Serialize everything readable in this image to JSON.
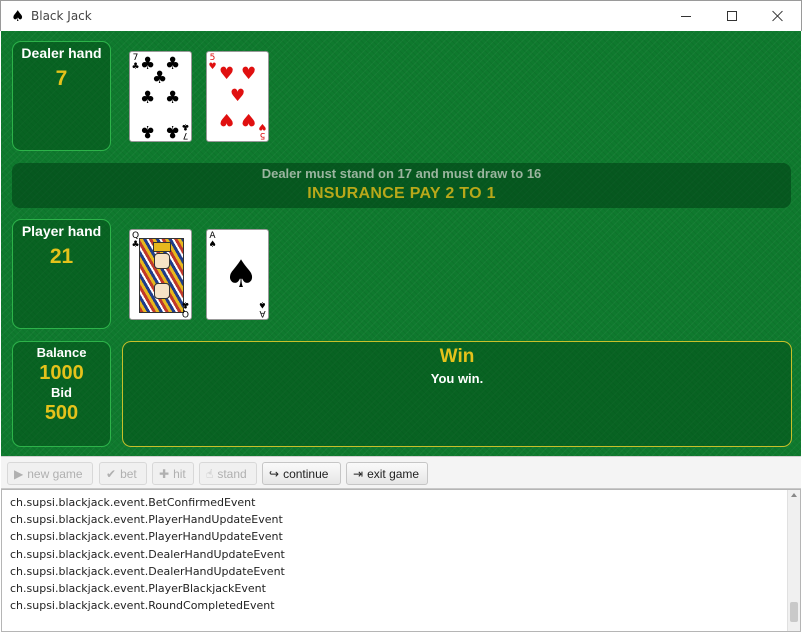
{
  "window": {
    "title": "Black Jack",
    "icon": "spade-icon"
  },
  "dealer": {
    "label": "Dealer hand",
    "value": "7",
    "cards": [
      {
        "rank": "7",
        "suit": "♣",
        "color": "black"
      },
      {
        "rank": "5",
        "suit": "♥",
        "color": "red"
      }
    ]
  },
  "banner": {
    "rule": "Dealer must stand on 17 and must draw to 16",
    "insurance": "INSURANCE PAY 2 TO 1"
  },
  "player": {
    "label": "Player hand",
    "value": "21",
    "cards": [
      {
        "rank": "Q",
        "suit": "♣",
        "color": "black"
      },
      {
        "rank": "A",
        "suit": "♠",
        "color": "black"
      }
    ]
  },
  "stats": {
    "balance_label": "Balance",
    "balance_value": "1000",
    "bid_label": "Bid",
    "bid_value": "500"
  },
  "result": {
    "title": "Win",
    "message": "You win."
  },
  "toolbar": {
    "new_game": "new game",
    "bet": "bet",
    "hit": "hit",
    "stand": "stand",
    "continue": "continue",
    "exit_game": "exit game"
  },
  "log": [
    "ch.supsi.blackjack.event.BetConfirmedEvent",
    "ch.supsi.blackjack.event.PlayerHandUpdateEvent",
    "ch.supsi.blackjack.event.PlayerHandUpdateEvent",
    "ch.supsi.blackjack.event.DealerHandUpdateEvent",
    "ch.supsi.blackjack.event.DealerHandUpdateEvent",
    "ch.supsi.blackjack.event.PlayerBlackjackEvent",
    "ch.supsi.blackjack.event.RoundCompletedEvent"
  ],
  "colors": {
    "felt": "#0f7a2e",
    "panel_border": "#2db34a",
    "accent_gold": "#e5c21b",
    "result_border": "#c8c02a"
  }
}
